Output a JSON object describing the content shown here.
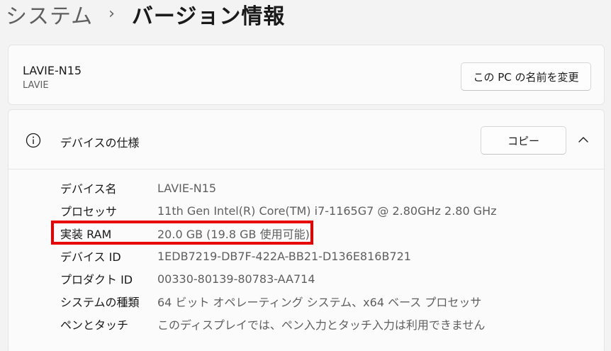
{
  "breadcrumb": {
    "parent": "システム",
    "separator": "›",
    "current": "バージョン情報"
  },
  "device": {
    "name": "LAVIE-N15",
    "model": "LAVIE",
    "rename_button": "この PC の名前を変更"
  },
  "specs": {
    "title": "デバイスの仕様",
    "copy_button": "コピー",
    "rows": [
      {
        "label": "デバイス名",
        "value": "LAVIE-N15"
      },
      {
        "label": "プロセッサ",
        "value": "11th Gen Intel(R) Core(TM) i7-1165G7 @ 2.80GHz   2.80 GHz"
      },
      {
        "label": "実装 RAM",
        "value": "20.0 GB (19.8 GB 使用可能)"
      },
      {
        "label": "デバイス ID",
        "value": "1EDB7219-DB7F-422A-BB21-D136E816B721"
      },
      {
        "label": "プロダクト ID",
        "value": "00330-80139-80783-AA714"
      },
      {
        "label": "システムの種類",
        "value": "64 ビット オペレーティング システム、x64 ベース プロセッサ"
      },
      {
        "label": "ペンとタッチ",
        "value": "このディスプレイでは、ペン入力とタッチ入力は利用できません"
      }
    ]
  },
  "colors": {
    "highlight": "#e60000",
    "background": "#f3f3f3",
    "card": "#fbfbfb"
  },
  "icons": {
    "info": "info-circle-icon",
    "chevron": "chevron-up-icon"
  }
}
